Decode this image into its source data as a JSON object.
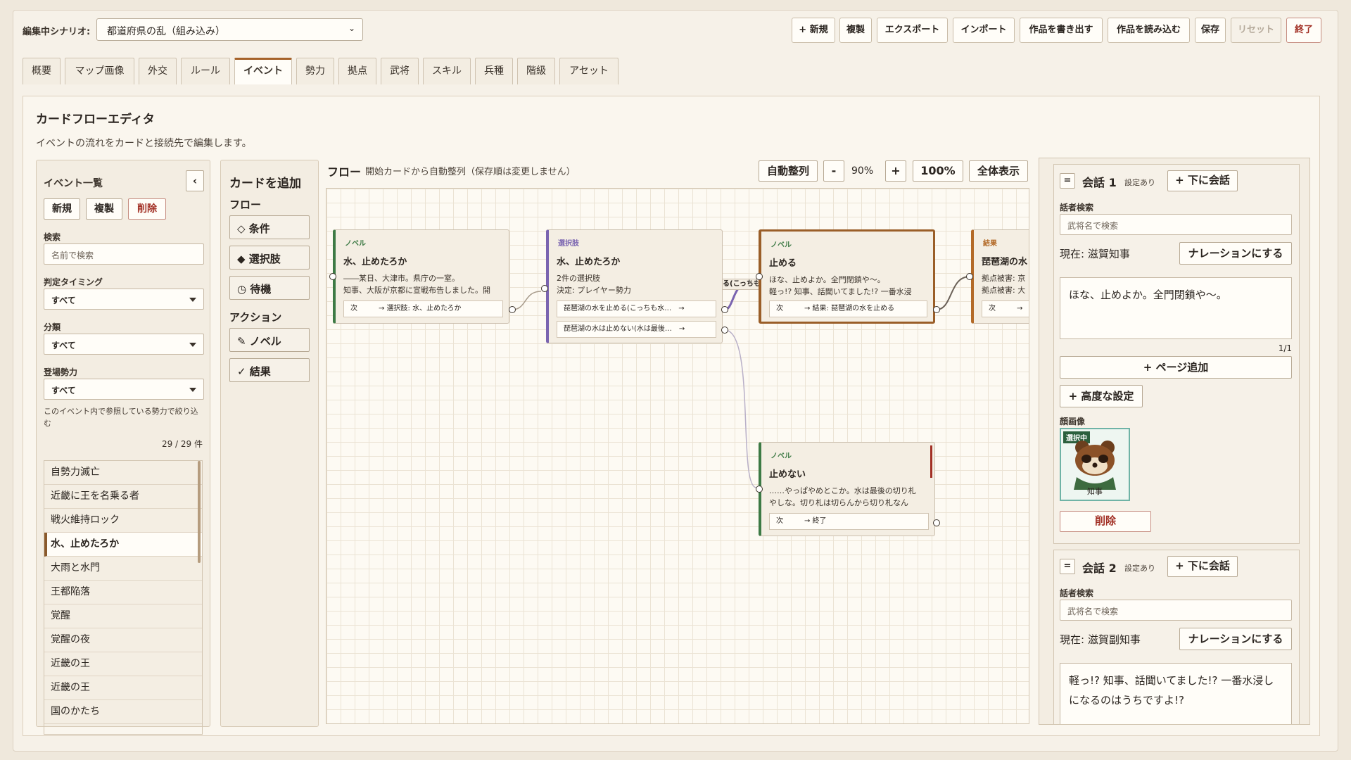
{
  "topbar": {
    "scenario_label": "編集中シナリオ:",
    "scenario_value": "都道府県の乱（組み込み）",
    "buttons": [
      "+ 新規",
      "複製",
      "エクスポート",
      "インポート",
      "作品を書き出す",
      "作品を読み込む",
      "保存",
      "リセット",
      "終了"
    ]
  },
  "tabs": [
    "概要",
    "マップ画像",
    "外交",
    "ルール",
    "イベント",
    "勢力",
    "拠点",
    "武将",
    "スキル",
    "兵種",
    "階級",
    "アセット"
  ],
  "active_tab": "イベント",
  "panel": {
    "title": "カードフローエディタ",
    "subtitle": "イベントの流れをカードと接続先で編集します。"
  },
  "event_list": {
    "heading": "イベント一覧",
    "collapse": "‹",
    "btn_new": "新規",
    "btn_copy": "複製",
    "btn_delete": "削除",
    "search_label": "検索",
    "search_placeholder": "名前で検索",
    "timing_label": "判定タイミング",
    "timing_value": "すべて",
    "category_label": "分類",
    "category_value": "すべて",
    "faction_label": "登場勢力",
    "faction_value": "すべて",
    "faction_hint": "このイベント内で参照している勢力で絞り込む",
    "count": "29 / 29 件",
    "items": [
      "自勢力滅亡",
      "近畿に王を名乗る者",
      "戦火維持ロック",
      "水、止めたろか",
      "大雨と水門",
      "王都陥落",
      "覚醒",
      "覚醒の夜",
      "近畿の王",
      "近畿の王",
      "国のかたち"
    ],
    "selected_index": 3
  },
  "add_card": {
    "heading": "カードを追加",
    "flow_label": "フロー",
    "flow_items": [
      "◇ 条件",
      "◆ 選択肢",
      "◷ 待機"
    ],
    "action_label": "アクション",
    "action_items": [
      "✎ ノベル",
      "✓ 結果"
    ]
  },
  "flow": {
    "heading": "フロー",
    "subtitle": "開始カードから自動整列（保存順は変更しません）",
    "auto_arrange": "自動整列",
    "zoom_out": "-",
    "zoom_level": "90%",
    "zoom_in": "+",
    "zoom_reset": "100%",
    "fit_all": "全体表示",
    "cards": [
      {
        "type": "ノベル",
        "title": "水、止めたろか",
        "lines": [
          "――某日、大津市。県庁の一室。",
          "知事、大阪が京都に宣戦布告しました。開"
        ],
        "rows": [
          "次　　　→ 選択肢: 水、止めたろか"
        ]
      },
      {
        "type": "選択肢",
        "title": "水、止めたろか",
        "lines": [
          "2件の選択肢",
          "決定: プレイヤー勢力"
        ],
        "rows": [
          "琵琶湖の水を止める(こっちも水…　→",
          "琵琶湖の水は止めない(水は最後…　→"
        ]
      },
      {
        "type": "ノベル",
        "title": "止める",
        "lines": [
          "ほな、止めよか。全門閉鎖や〜。",
          "軽っ!? 知事、話聞いてました!? 一番水浸"
        ],
        "rows": [
          "次　　　→ 結果: 琵琶湖の水を止める"
        ]
      },
      {
        "type": "結果",
        "title": "琵琶湖の水",
        "lines": [
          "拠点被害: 京",
          "拠点被害: 大"
        ],
        "rows": [
          "次　　　→"
        ]
      },
      {
        "type": "ノベル",
        "title": "止めない",
        "lines": [
          "……やっぱやめとこか。水は最後の切り札",
          "やしな。切り札は切らんから切り札なん"
        ],
        "rows": [
          "次　　　→ 終了"
        ]
      }
    ],
    "edge_label": "る(こっちも"
  },
  "conversations": [
    {
      "toggle": "=",
      "title": "会話 1",
      "badge": "設定あり",
      "add_below": "+ 下に会話",
      "speaker_label": "話者検索",
      "speaker_placeholder": "武将名で検索",
      "current": "現在: 滋賀知事",
      "narration": "ナレーションにする",
      "text": "ほな、止めよか。全門閉鎖や〜。",
      "page": "1/1",
      "add_page": "+ ページ追加",
      "advanced": "+ 高度な設定",
      "face_label": "顔画像",
      "face_badge": "選択中",
      "face_name": "知事",
      "delete": "削除"
    },
    {
      "toggle": "=",
      "title": "会話 2",
      "badge": "設定あり",
      "add_below": "+ 下に会話",
      "speaker_label": "話者検索",
      "speaker_placeholder": "武将名で検索",
      "current": "現在: 滋賀副知事",
      "narration": "ナレーションにする",
      "text": "軽っ!? 知事、話聞いてました!? 一番水浸しになるのはうちですよ!?"
    }
  ],
  "colors": {
    "novel": "#3d7a45",
    "choice": "#7a64b0",
    "result": "#b36a28",
    "accent": "#a5622a",
    "danger": "#a23025"
  }
}
